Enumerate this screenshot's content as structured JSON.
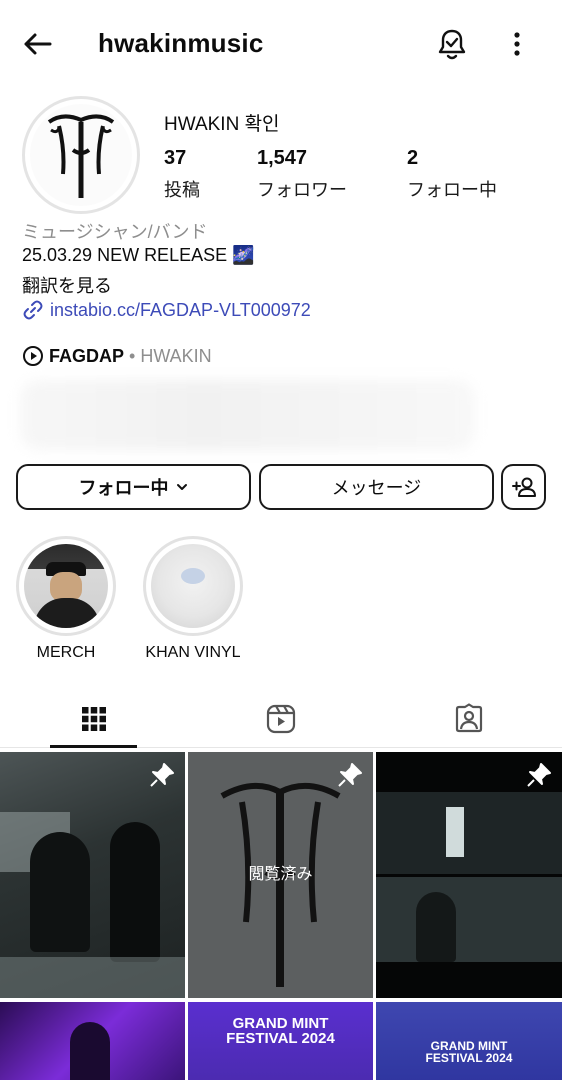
{
  "header": {
    "username": "hwakinmusic"
  },
  "profile": {
    "display_name": "HWAKIN 확인",
    "stats": [
      {
        "value": "37",
        "label": "投稿"
      },
      {
        "value": "1,547",
        "label": "フォロワー"
      },
      {
        "value": "2",
        "label": "フォロー中"
      }
    ],
    "category": "ミュージシャン/バンド",
    "bio": "25.03.29 NEW RELEASE 🌌",
    "translate": "翻訳を見る",
    "link": "instabio.cc/FAGDAP-VLT000972",
    "thread": {
      "strong": "FAGDAP",
      "sep": "•",
      "muted": "HWAKIN"
    }
  },
  "buttons": {
    "follow": "フォロー中",
    "message": "メッセージ"
  },
  "highlights": [
    {
      "label": "MERCH"
    },
    {
      "label": "KHAN VINYL"
    }
  ],
  "grid": {
    "viewed_label": "閲覧済み",
    "festival_title_line1": "GRAND MINT",
    "festival_title_line2": "FESTIVAL 2024"
  },
  "colors": {
    "link": "#3d4bb8",
    "muted": "#8e8e8e",
    "border": "#1a1a1a"
  },
  "icons": [
    "back-arrow-icon",
    "bell-check-icon",
    "more-vertical-icon",
    "link-icon",
    "threads-icon",
    "chevron-down-icon",
    "add-person-icon",
    "grid-icon",
    "reels-icon",
    "tagged-icon",
    "pin-icon"
  ]
}
